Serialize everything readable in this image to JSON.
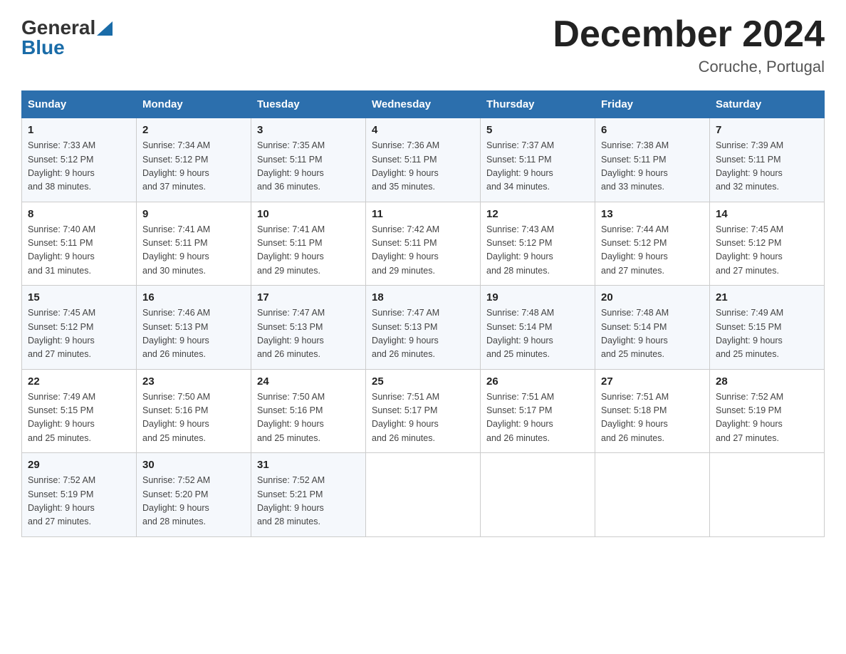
{
  "logo": {
    "general": "General",
    "blue": "Blue",
    "triangle": "▶"
  },
  "title": "December 2024",
  "subtitle": "Coruche, Portugal",
  "days_of_week": [
    "Sunday",
    "Monday",
    "Tuesday",
    "Wednesday",
    "Thursday",
    "Friday",
    "Saturday"
  ],
  "weeks": [
    [
      {
        "day": "1",
        "info": "Sunrise: 7:33 AM\nSunset: 5:12 PM\nDaylight: 9 hours\nand 38 minutes."
      },
      {
        "day": "2",
        "info": "Sunrise: 7:34 AM\nSunset: 5:12 PM\nDaylight: 9 hours\nand 37 minutes."
      },
      {
        "day": "3",
        "info": "Sunrise: 7:35 AM\nSunset: 5:11 PM\nDaylight: 9 hours\nand 36 minutes."
      },
      {
        "day": "4",
        "info": "Sunrise: 7:36 AM\nSunset: 5:11 PM\nDaylight: 9 hours\nand 35 minutes."
      },
      {
        "day": "5",
        "info": "Sunrise: 7:37 AM\nSunset: 5:11 PM\nDaylight: 9 hours\nand 34 minutes."
      },
      {
        "day": "6",
        "info": "Sunrise: 7:38 AM\nSunset: 5:11 PM\nDaylight: 9 hours\nand 33 minutes."
      },
      {
        "day": "7",
        "info": "Sunrise: 7:39 AM\nSunset: 5:11 PM\nDaylight: 9 hours\nand 32 minutes."
      }
    ],
    [
      {
        "day": "8",
        "info": "Sunrise: 7:40 AM\nSunset: 5:11 PM\nDaylight: 9 hours\nand 31 minutes."
      },
      {
        "day": "9",
        "info": "Sunrise: 7:41 AM\nSunset: 5:11 PM\nDaylight: 9 hours\nand 30 minutes."
      },
      {
        "day": "10",
        "info": "Sunrise: 7:41 AM\nSunset: 5:11 PM\nDaylight: 9 hours\nand 29 minutes."
      },
      {
        "day": "11",
        "info": "Sunrise: 7:42 AM\nSunset: 5:11 PM\nDaylight: 9 hours\nand 29 minutes."
      },
      {
        "day": "12",
        "info": "Sunrise: 7:43 AM\nSunset: 5:12 PM\nDaylight: 9 hours\nand 28 minutes."
      },
      {
        "day": "13",
        "info": "Sunrise: 7:44 AM\nSunset: 5:12 PM\nDaylight: 9 hours\nand 27 minutes."
      },
      {
        "day": "14",
        "info": "Sunrise: 7:45 AM\nSunset: 5:12 PM\nDaylight: 9 hours\nand 27 minutes."
      }
    ],
    [
      {
        "day": "15",
        "info": "Sunrise: 7:45 AM\nSunset: 5:12 PM\nDaylight: 9 hours\nand 27 minutes."
      },
      {
        "day": "16",
        "info": "Sunrise: 7:46 AM\nSunset: 5:13 PM\nDaylight: 9 hours\nand 26 minutes."
      },
      {
        "day": "17",
        "info": "Sunrise: 7:47 AM\nSunset: 5:13 PM\nDaylight: 9 hours\nand 26 minutes."
      },
      {
        "day": "18",
        "info": "Sunrise: 7:47 AM\nSunset: 5:13 PM\nDaylight: 9 hours\nand 26 minutes."
      },
      {
        "day": "19",
        "info": "Sunrise: 7:48 AM\nSunset: 5:14 PM\nDaylight: 9 hours\nand 25 minutes."
      },
      {
        "day": "20",
        "info": "Sunrise: 7:48 AM\nSunset: 5:14 PM\nDaylight: 9 hours\nand 25 minutes."
      },
      {
        "day": "21",
        "info": "Sunrise: 7:49 AM\nSunset: 5:15 PM\nDaylight: 9 hours\nand 25 minutes."
      }
    ],
    [
      {
        "day": "22",
        "info": "Sunrise: 7:49 AM\nSunset: 5:15 PM\nDaylight: 9 hours\nand 25 minutes."
      },
      {
        "day": "23",
        "info": "Sunrise: 7:50 AM\nSunset: 5:16 PM\nDaylight: 9 hours\nand 25 minutes."
      },
      {
        "day": "24",
        "info": "Sunrise: 7:50 AM\nSunset: 5:16 PM\nDaylight: 9 hours\nand 25 minutes."
      },
      {
        "day": "25",
        "info": "Sunrise: 7:51 AM\nSunset: 5:17 PM\nDaylight: 9 hours\nand 26 minutes."
      },
      {
        "day": "26",
        "info": "Sunrise: 7:51 AM\nSunset: 5:17 PM\nDaylight: 9 hours\nand 26 minutes."
      },
      {
        "day": "27",
        "info": "Sunrise: 7:51 AM\nSunset: 5:18 PM\nDaylight: 9 hours\nand 26 minutes."
      },
      {
        "day": "28",
        "info": "Sunrise: 7:52 AM\nSunset: 5:19 PM\nDaylight: 9 hours\nand 27 minutes."
      }
    ],
    [
      {
        "day": "29",
        "info": "Sunrise: 7:52 AM\nSunset: 5:19 PM\nDaylight: 9 hours\nand 27 minutes."
      },
      {
        "day": "30",
        "info": "Sunrise: 7:52 AM\nSunset: 5:20 PM\nDaylight: 9 hours\nand 28 minutes."
      },
      {
        "day": "31",
        "info": "Sunrise: 7:52 AM\nSunset: 5:21 PM\nDaylight: 9 hours\nand 28 minutes."
      },
      {
        "day": "",
        "info": ""
      },
      {
        "day": "",
        "info": ""
      },
      {
        "day": "",
        "info": ""
      },
      {
        "day": "",
        "info": ""
      }
    ]
  ]
}
